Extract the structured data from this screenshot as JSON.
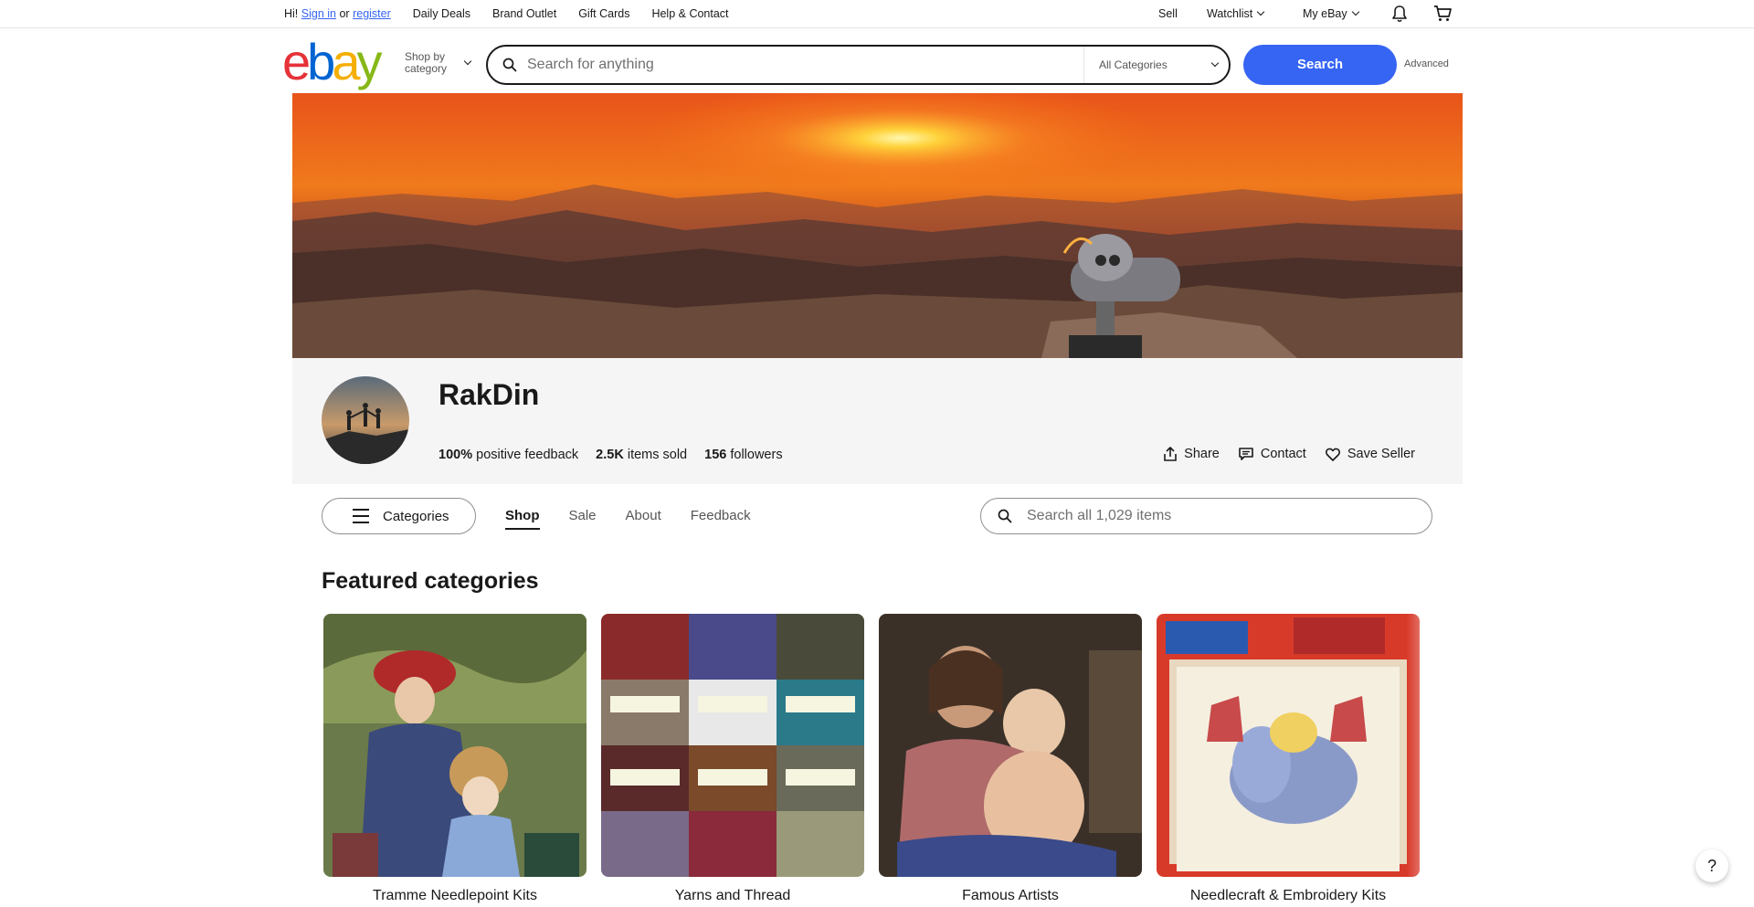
{
  "topbar": {
    "greeting": "Hi!",
    "sign_in": "Sign in",
    "or": "or",
    "register": "register",
    "links": [
      "Daily Deals",
      "Brand Outlet",
      "Gift Cards",
      "Help & Contact"
    ],
    "sell": "Sell",
    "watchlist": "Watchlist",
    "my_ebay": "My eBay"
  },
  "header": {
    "logo": {
      "e": "e",
      "b": "b",
      "a": "a",
      "y": "y"
    },
    "shop_by_line1": "Shop by",
    "shop_by_line2": "category",
    "search_placeholder": "Search for anything",
    "category_select": "All Categories",
    "search_button": "Search",
    "advanced": "Advanced"
  },
  "store": {
    "name": "RakDin",
    "feedback_value": "100%",
    "feedback_label": "positive feedback",
    "sold_value": "2.5K",
    "sold_label": "items sold",
    "followers_value": "156",
    "followers_label": "followers",
    "share": "Share",
    "contact": "Contact",
    "save_seller": "Save Seller"
  },
  "store_nav": {
    "categories": "Categories",
    "tabs": [
      "Shop",
      "Sale",
      "About",
      "Feedback"
    ],
    "active_tab": "Shop",
    "search_placeholder": "Search all 1,029 items"
  },
  "featured": {
    "title": "Featured categories",
    "items": [
      {
        "label": "Tramme Needlepoint Kits"
      },
      {
        "label": "Yarns and Thread"
      },
      {
        "label": "Famous Artists"
      },
      {
        "label": "Needlecraft & Embroidery Kits"
      }
    ]
  },
  "help": "?",
  "colors": {
    "accent": "#3665f3",
    "text": "#191919",
    "muted": "#707070",
    "panel": "#f5f5f5"
  }
}
